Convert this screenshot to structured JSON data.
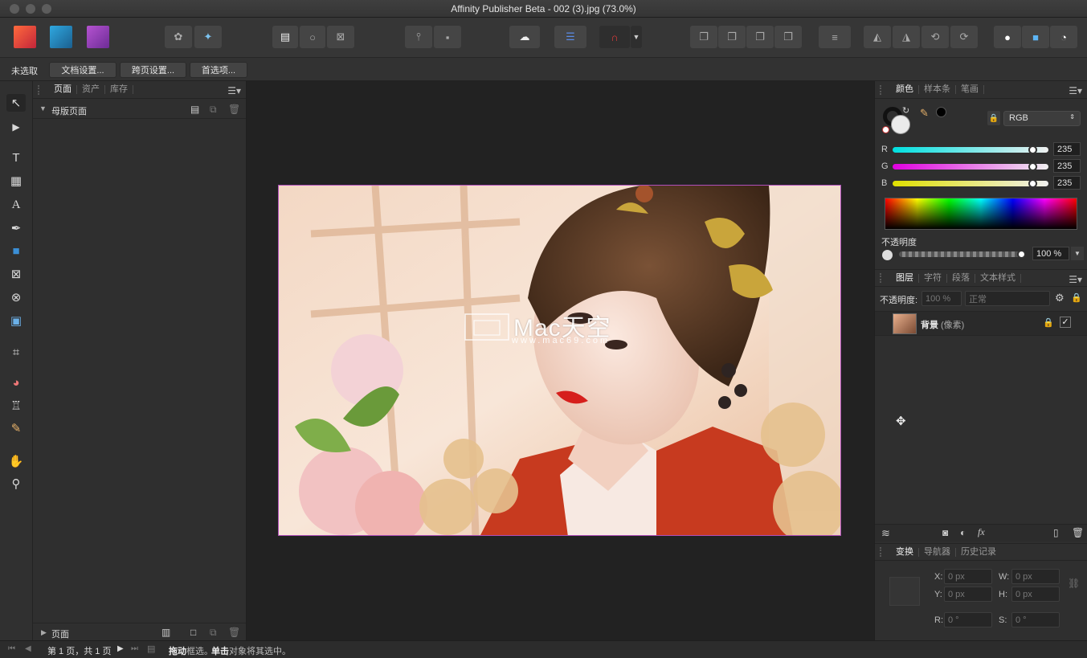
{
  "window": {
    "title": "Affinity Publisher Beta - 002 (3).jpg (73.0%)"
  },
  "context_bar": {
    "selection": "未选取",
    "doc_setup": "文档设置...",
    "spread_setup": "跨页设置...",
    "preferences": "首选项..."
  },
  "pages_panel": {
    "tabs": [
      "页面",
      "资产",
      "库存"
    ],
    "master_pages": "母版页面",
    "pages": "页面"
  },
  "watermark": {
    "line1": "Mac天空",
    "line2": "www.mac69.com"
  },
  "color_panel": {
    "tabs": [
      "颜色",
      "样本条",
      "笔画"
    ],
    "model": "RGB",
    "r_label": "R",
    "r_value": "235",
    "g_label": "G",
    "g_value": "235",
    "b_label": "B",
    "b_value": "235",
    "opacity_label": "不透明度",
    "opacity_value": "100 %",
    "accent": "#ebebeb"
  },
  "layers_panel": {
    "tabs": [
      "图层",
      "字符",
      "段落",
      "文本样式"
    ],
    "opacity_label": "不透明度:",
    "opacity_value": "100 %",
    "blend_mode": "正常",
    "layer_name": "背景",
    "layer_type": "(像素)"
  },
  "transform_panel": {
    "tabs": [
      "变换",
      "导航器",
      "历史记录"
    ],
    "x_label": "X:",
    "x_value": "0 px",
    "y_label": "Y:",
    "y_value": "0 px",
    "w_label": "W:",
    "w_value": "0 px",
    "h_label": "H:",
    "h_value": "0 px",
    "r_label": "R:",
    "r_value": "0 °",
    "s_label": "S:",
    "s_value": "0 °"
  },
  "status": {
    "page_info": "第 1 页，共 1 页",
    "hint_bold1": "拖动",
    "hint_text1": " 框选。",
    "hint_bold2": "单击",
    "hint_text2": " 对象将其选中。"
  }
}
